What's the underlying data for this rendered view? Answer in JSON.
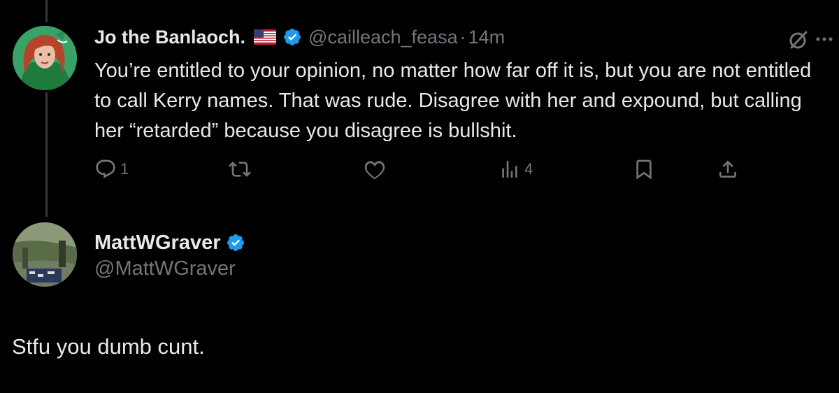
{
  "tweet1": {
    "author_name": "Jo the Banlaoch.",
    "flag_icon": "us-flag-icon",
    "handle": "@cailleach_feasa",
    "separator": "·",
    "time": "14m",
    "text": "You’re entitled to your opinion, no matter how far off it is, but you are not entitled to call Kerry names. That was rude. Disagree with her and expound, but calling her “retarded” because you disagree is bullshit.",
    "actions": {
      "reply_count": "1",
      "views_count": "4"
    }
  },
  "tweet2": {
    "author_name": "MattWGraver",
    "handle": "@MattWGraver",
    "text": "Stfu you dumb cunt."
  },
  "colors": {
    "background": "#000000",
    "text": "#e7e9ea",
    "secondary": "#71767b",
    "verified": "#1d9bf0"
  }
}
